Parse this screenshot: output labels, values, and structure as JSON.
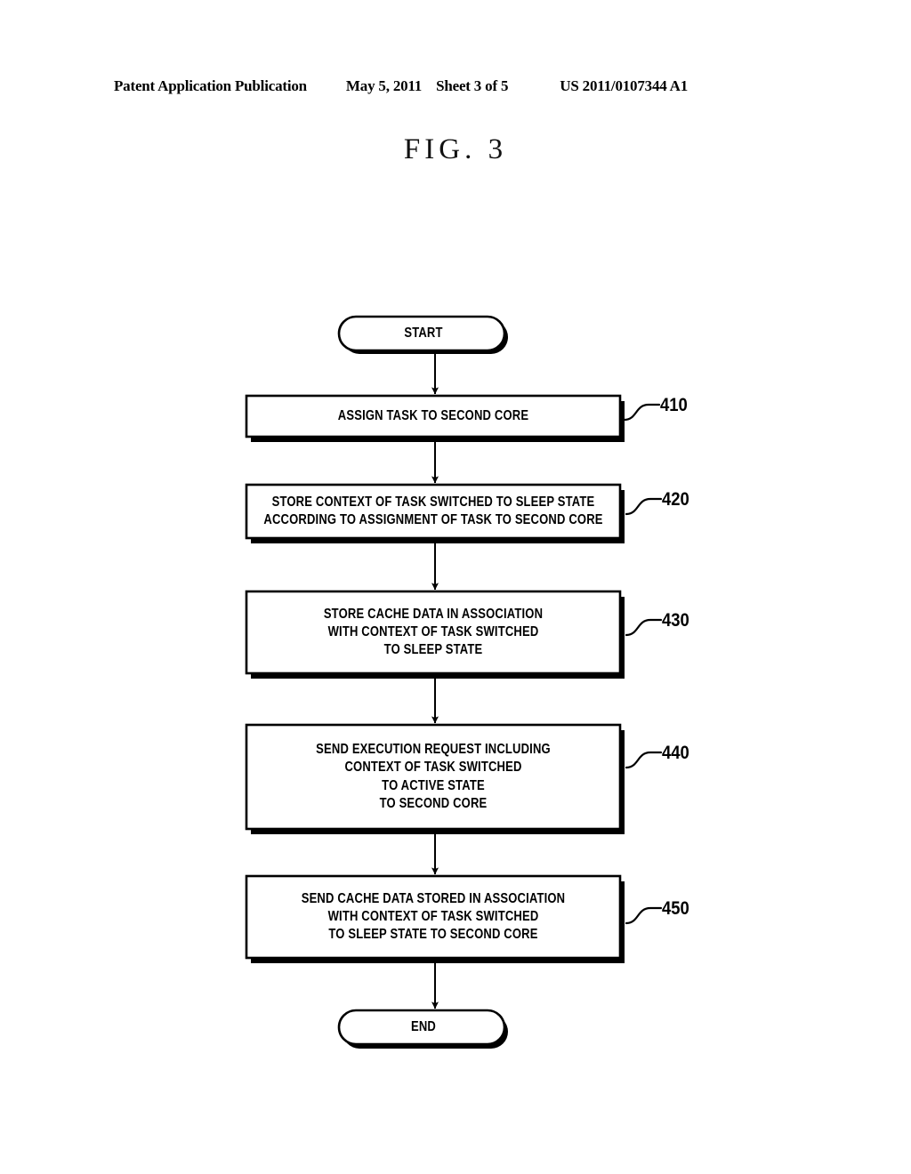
{
  "header": {
    "publication": "Patent Application Publication",
    "date": "May 5, 2011",
    "sheet": "Sheet 3 of 5",
    "doc_number": "US 2011/0107344 A1"
  },
  "figure": {
    "title": "FIG. 3"
  },
  "flowchart": {
    "start": {
      "label": "START"
    },
    "end": {
      "label": "END"
    },
    "steps": [
      {
        "ref": "410",
        "lines": [
          "ASSIGN TASK TO SECOND CORE"
        ]
      },
      {
        "ref": "420",
        "lines": [
          "STORE CONTEXT OF TASK SWITCHED TO SLEEP STATE",
          "ACCORDING TO ASSIGNMENT OF TASK TO SECOND CORE"
        ]
      },
      {
        "ref": "430",
        "lines": [
          "STORE CACHE DATA IN ASSOCIATION",
          "WITH CONTEXT OF TASK SWITCHED",
          "TO SLEEP STATE"
        ]
      },
      {
        "ref": "440",
        "lines": [
          "SEND EXECUTION REQUEST INCLUDING",
          "CONTEXT OF TASK SWITCHED",
          "TO ACTIVE STATE",
          "TO SECOND CORE"
        ]
      },
      {
        "ref": "450",
        "lines": [
          "SEND CACHE DATA STORED IN ASSOCIATION",
          "WITH CONTEXT OF TASK SWITCHED",
          "TO SLEEP STATE TO SECOND CORE"
        ]
      }
    ]
  },
  "colors": {
    "ink": "#000000",
    "paper": "#ffffff"
  }
}
